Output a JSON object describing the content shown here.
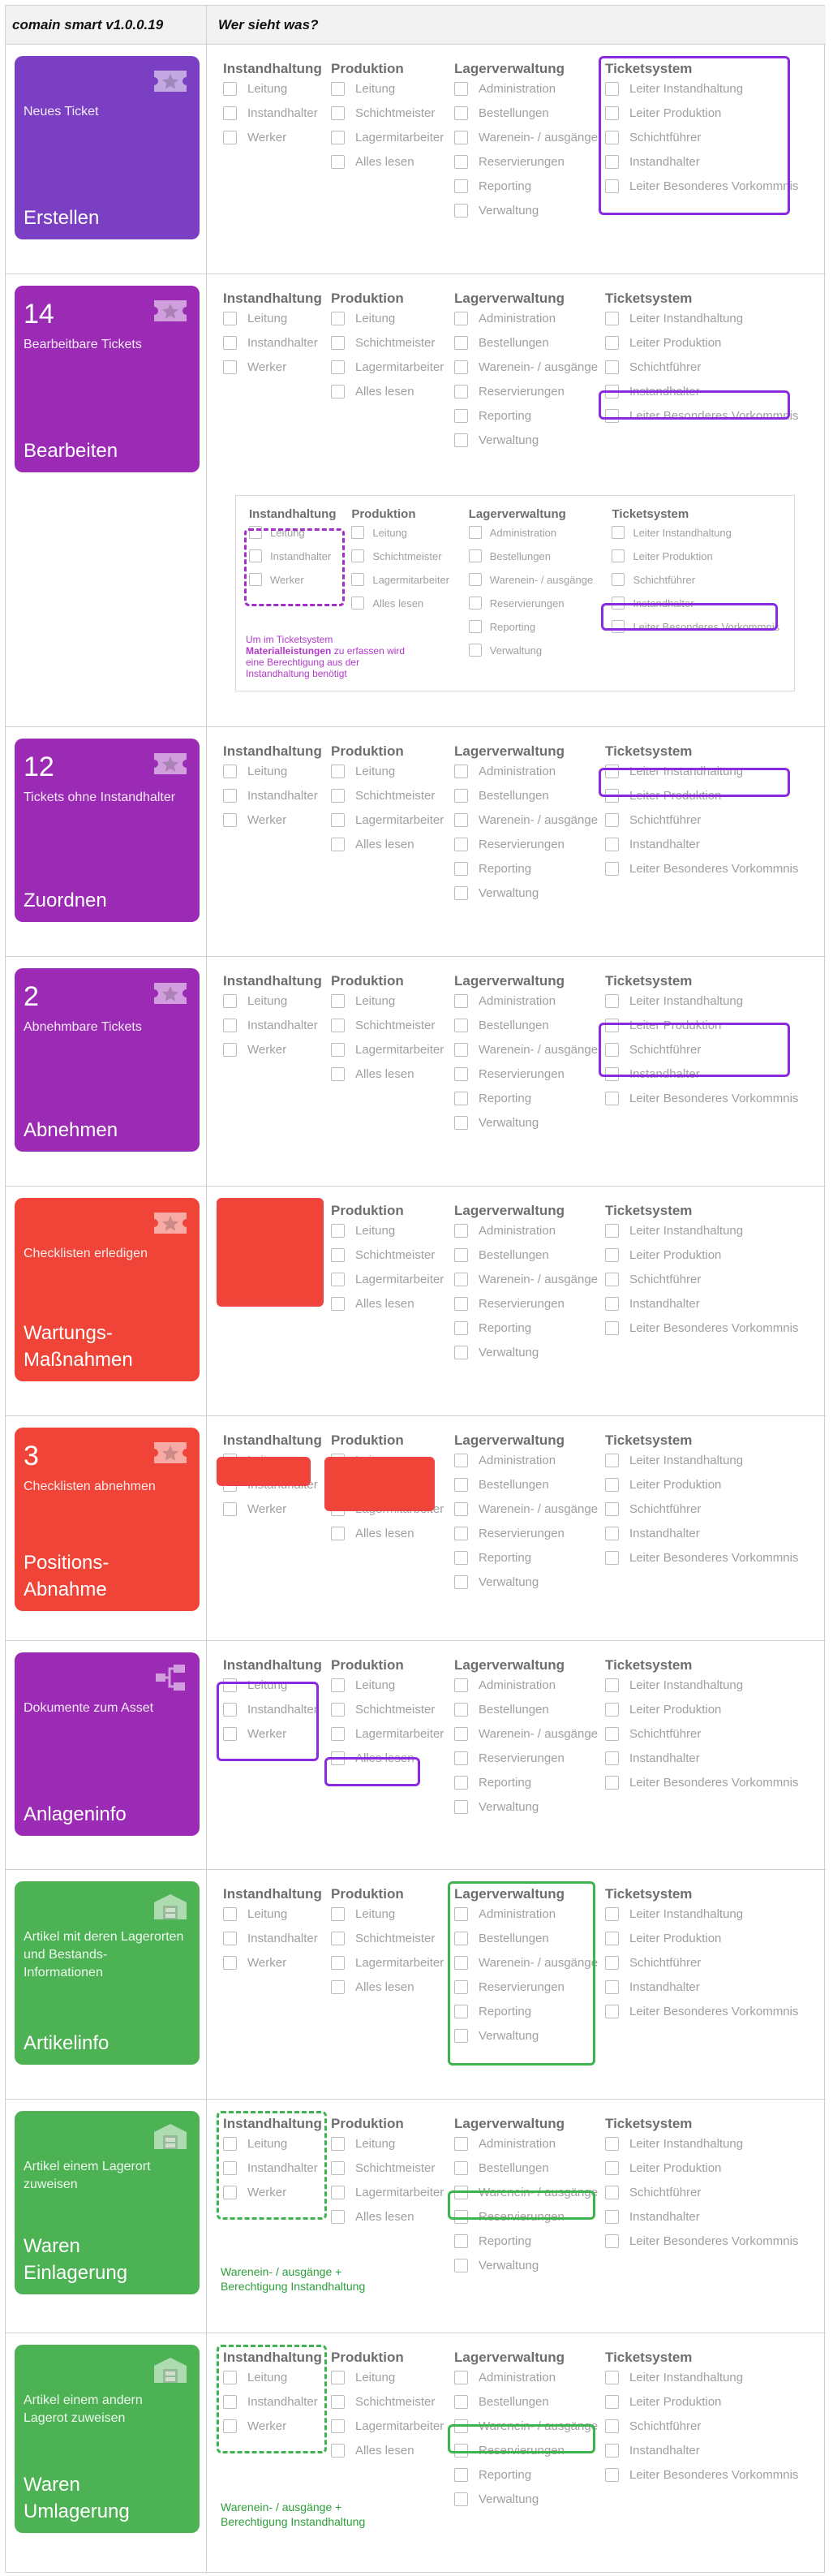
{
  "header": {
    "left": "comain smart v1.0.0.19",
    "right": "Wer sieht was?"
  },
  "groups": {
    "instandhaltung": {
      "title": "Instandhaltung",
      "items": [
        "Leitung",
        "Instandhalter",
        "Werker"
      ]
    },
    "produktion": {
      "title": "Produktion",
      "items": [
        "Leitung",
        "Schichtmeister",
        "Lagermitarbeiter",
        "Alles lesen"
      ]
    },
    "lagerverwaltung": {
      "title": "Lagerverwaltung",
      "items": [
        "Administration",
        "Bestellungen",
        "Warenein- / ausgänge",
        "Reservierungen",
        "Reporting",
        "Verwaltung"
      ]
    },
    "ticketsystem": {
      "title": "Ticketsystem",
      "items": [
        "Leiter Instandhaltung",
        "Leiter Produktion",
        "Schichtführer",
        "Instandhalter",
        "Leiter Besonderes Vorkommnis"
      ]
    }
  },
  "rows": [
    {
      "id": "erstellen",
      "color": "#7b3fc4",
      "icon": "ticket-star-icon",
      "num": "",
      "sub": "Neues Ticket",
      "title": "Erstellen"
    },
    {
      "id": "bearbeiten",
      "color": "#9b2ab5",
      "icon": "ticket-star-icon",
      "num": "14",
      "sub": "Bearbeitbare Tickets",
      "title": "Bearbeiten",
      "note_pre": "Um im Ticketsystem",
      "note_bold": "Materialleistungen",
      "note_mid": "zu erfassen wird",
      "note_post": "eine Berechtigung aus der Instandhaltung benötigt"
    },
    {
      "id": "zuordnen",
      "color": "#9b2ab5",
      "icon": "ticket-star-icon",
      "num": "12",
      "sub": "Tickets ohne Instandhalter",
      "title": "Zuordnen"
    },
    {
      "id": "abnehmen",
      "color": "#9b2ab5",
      "icon": "ticket-star-icon",
      "num": "2",
      "sub": "Abnehmbare Tickets",
      "title": "Abnehmen"
    },
    {
      "id": "wartung",
      "color": "#f04438",
      "icon": "ticket-star-icon",
      "num": "",
      "sub": "Checklisten erledigen",
      "title": "Wartungs-Maßnahmen"
    },
    {
      "id": "positions",
      "color": "#f04438",
      "icon": "ticket-star-icon",
      "num": "3",
      "sub": "Checklisten abnehmen",
      "title": "Positions-Abnahme"
    },
    {
      "id": "anlageninfo",
      "color": "#9b2ab5",
      "icon": "hierarchy-icon",
      "num": "",
      "sub": "Dokumente zum Asset",
      "title": "Anlageninfo"
    },
    {
      "id": "artikelinfo",
      "color": "#4cb253",
      "icon": "warehouse-icon",
      "num": "",
      "sub": "Artikel mit deren Lagerorten und Bestands-Informationen",
      "title": "Artikelinfo"
    },
    {
      "id": "einlagerung",
      "color": "#4cb253",
      "icon": "warehouse-icon",
      "num": "",
      "sub": "Artikel einem Lagerort zuweisen",
      "title": "Waren Einlagerung",
      "gnote": "Warenein- / ausgänge + Berechtigung Instandhaltung"
    },
    {
      "id": "umlagerung",
      "color": "#4cb253",
      "icon": "warehouse-icon",
      "num": "",
      "sub": "Artikel einem andern Lagerot zuweisen",
      "title": "Waren Umlagerung",
      "gnote": "Warenein- / ausgänge + Berechtigung Instandhaltung"
    }
  ]
}
